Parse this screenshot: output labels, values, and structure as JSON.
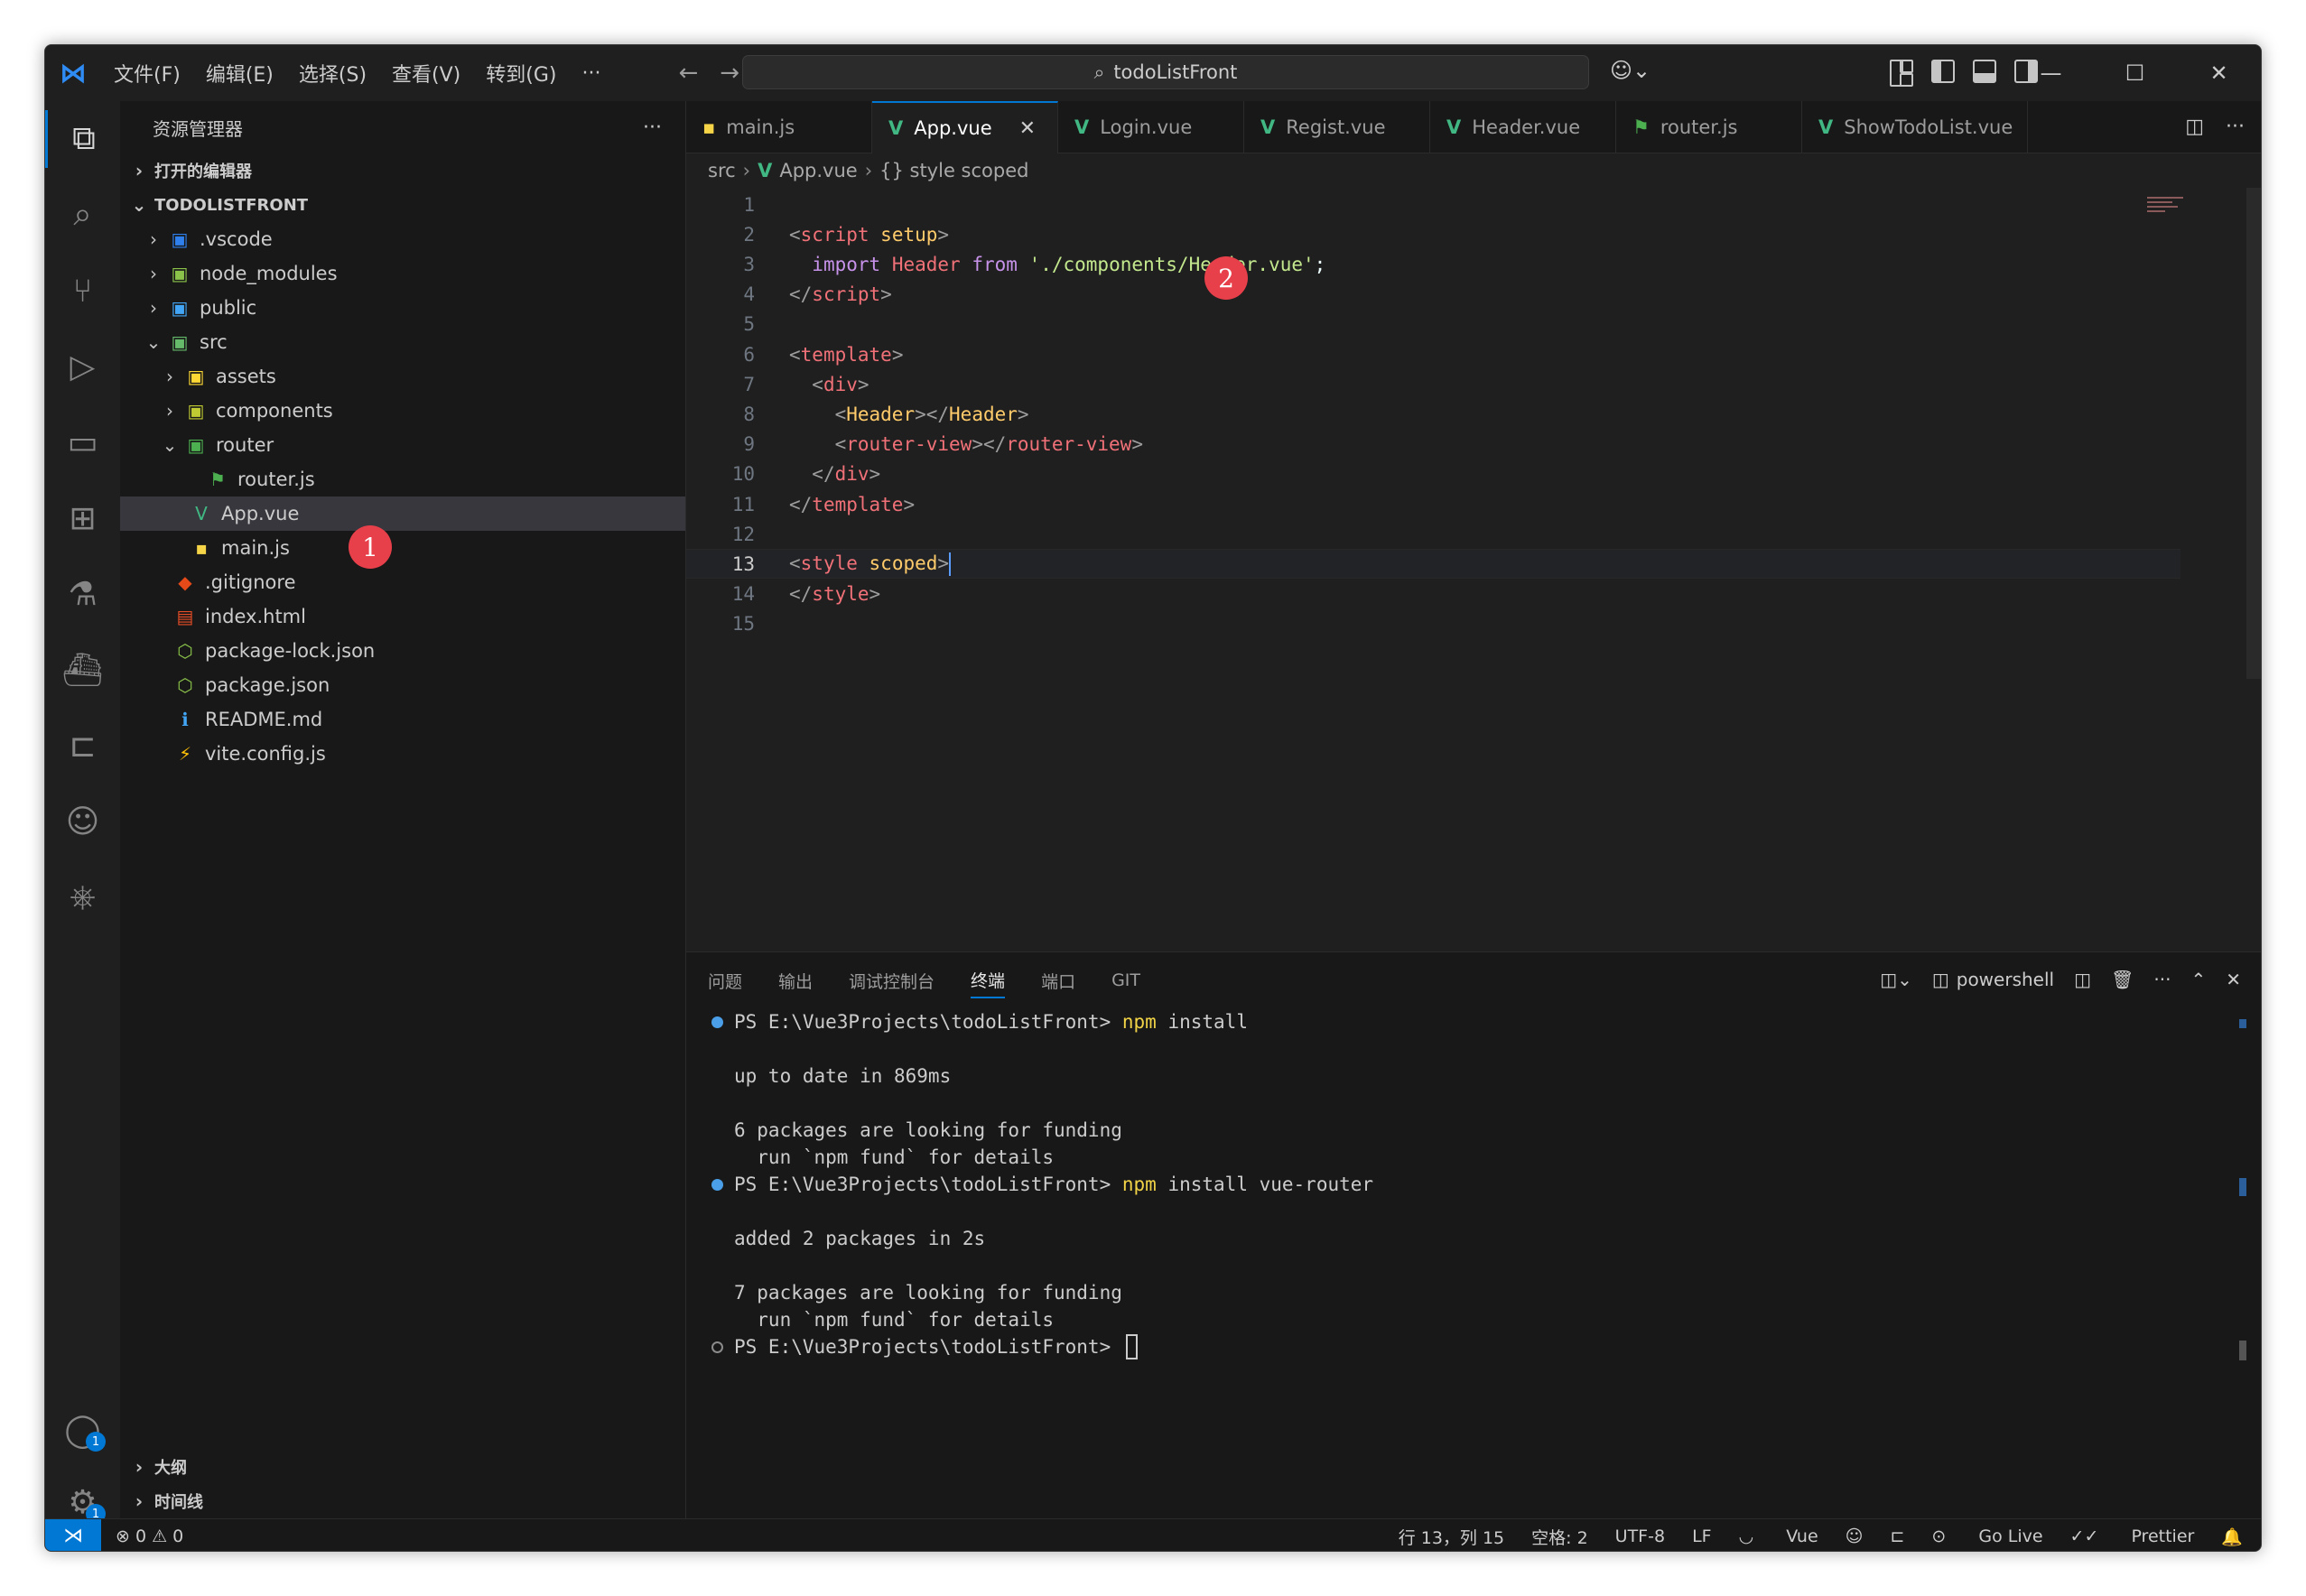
{
  "titlebar": {
    "menu": [
      "文件(F)",
      "编辑(E)",
      "选择(S)",
      "查看(V)",
      "转到(G)",
      "···"
    ],
    "search": "todoListFront",
    "back": "←",
    "forward": "→"
  },
  "sidebar": {
    "title": "资源管理器",
    "more": "···",
    "open_editors": "打开的编辑器",
    "project": "TODOLISTFRONT",
    "outline": "大纲",
    "timeline": "时间线",
    "tree": [
      {
        "label": ".vscode",
        "icon": "vscode-folder-icon",
        "glyph": "▣",
        "color": "#2f80ed",
        "chevron": "›",
        "indent": 0
      },
      {
        "label": "node_modules",
        "icon": "node-folder-icon",
        "glyph": "▣",
        "color": "#8bc34a",
        "chevron": "›",
        "indent": 0
      },
      {
        "label": "public",
        "icon": "public-folder-icon",
        "glyph": "▣",
        "color": "#42a5f5",
        "chevron": "›",
        "indent": 0
      },
      {
        "label": "src",
        "icon": "src-folder-icon",
        "glyph": "▣",
        "color": "#66bb6a",
        "chevron": "⌄",
        "indent": 0
      },
      {
        "label": "assets",
        "icon": "assets-folder-icon",
        "glyph": "▣",
        "color": "#fdd835",
        "chevron": "›",
        "indent": 1
      },
      {
        "label": "components",
        "icon": "components-folder-icon",
        "glyph": "▣",
        "color": "#c0ca33",
        "chevron": "›",
        "indent": 1
      },
      {
        "label": "router",
        "icon": "router-folder-icon",
        "glyph": "▣",
        "color": "#4caf50",
        "chevron": "⌄",
        "indent": 1
      },
      {
        "label": "router.js",
        "icon": "router-file-icon",
        "glyph": "⚑",
        "color": "#4caf50",
        "chevron": "",
        "indent": 2
      },
      {
        "label": "App.vue",
        "icon": "vue-file-icon",
        "glyph": "V",
        "color": "#41b883",
        "chevron": "",
        "indent": 1,
        "selected": true
      },
      {
        "label": "main.js",
        "icon": "js-file-icon",
        "glyph": "▪",
        "color": "#f5d547",
        "chevron": "",
        "indent": 1
      },
      {
        "label": ".gitignore",
        "icon": "git-file-icon",
        "glyph": "◆",
        "color": "#e64a19",
        "chevron": "",
        "indent": 0
      },
      {
        "label": "index.html",
        "icon": "html-file-icon",
        "glyph": "▤",
        "color": "#e44d26",
        "chevron": "",
        "indent": 0
      },
      {
        "label": "package-lock.json",
        "icon": "node-file-icon",
        "glyph": "⬡",
        "color": "#8bc34a",
        "chevron": "",
        "indent": 0
      },
      {
        "label": "package.json",
        "icon": "node-file-icon",
        "glyph": "⬡",
        "color": "#8bc34a",
        "chevron": "",
        "indent": 0
      },
      {
        "label": "README.md",
        "icon": "info-file-icon",
        "glyph": "ℹ",
        "color": "#42a5f5",
        "chevron": "",
        "indent": 0
      },
      {
        "label": "vite.config.js",
        "icon": "vite-file-icon",
        "glyph": "⚡",
        "color": "#ffc107",
        "chevron": "",
        "indent": 0
      }
    ],
    "marker1": "1"
  },
  "tabs": [
    {
      "label": "main.js",
      "icon": "js-file-icon",
      "glyph": "▪",
      "color": "#f5d547"
    },
    {
      "label": "App.vue",
      "icon": "vue-file-icon",
      "glyph": "V",
      "color": "#41b883",
      "active": true
    },
    {
      "label": "Login.vue",
      "icon": "vue-file-icon",
      "glyph": "V",
      "color": "#41b883"
    },
    {
      "label": "Regist.vue",
      "icon": "vue-file-icon",
      "glyph": "V",
      "color": "#41b883"
    },
    {
      "label": "Header.vue",
      "icon": "vue-file-icon",
      "glyph": "V",
      "color": "#41b883"
    },
    {
      "label": "router.js",
      "icon": "router-file-icon",
      "glyph": "⚑",
      "color": "#4caf50"
    },
    {
      "label": "ShowTodoList.vue",
      "icon": "vue-file-icon",
      "glyph": "V",
      "color": "#41b883"
    }
  ],
  "tab_close": "✕",
  "breadcrumb": {
    "folder": "src",
    "file": "App.vue",
    "symbol": "{} style scoped"
  },
  "editor": {
    "marker2": "2",
    "current_line": 13,
    "lines": [
      {
        "n": "1",
        "html": ""
      },
      {
        "n": "2",
        "html": "<span class='t-br'>&lt;</span><span class='t-tag'>script</span> <span class='t-attr'>setup</span><span class='t-br'>&gt;</span>"
      },
      {
        "n": "3",
        "html": "  <span class='t-kw'>import</span> <span class='t-tag'>Header</span> <span class='t-kw'>from</span> <span class='t-str'>'./components/Header.vue'</span><span class='t-plain'>;</span>"
      },
      {
        "n": "4",
        "html": "<span class='t-br'>&lt;/</span><span class='t-tag'>script</span><span class='t-br'>&gt;</span>"
      },
      {
        "n": "5",
        "html": ""
      },
      {
        "n": "6",
        "html": "<span class='t-br'>&lt;</span><span class='t-tag'>template</span><span class='t-br'>&gt;</span>"
      },
      {
        "n": "7",
        "html": "  <span class='t-br'>&lt;</span><span class='t-tag'>div</span><span class='t-br'>&gt;</span>"
      },
      {
        "n": "8",
        "html": "    <span class='t-br'>&lt;</span><span class='t-comp'>Header</span><span class='t-br'>&gt;&lt;/</span><span class='t-comp'>Header</span><span class='t-br'>&gt;</span>"
      },
      {
        "n": "9",
        "html": "    <span class='t-br'>&lt;</span><span class='t-tag'>router-view</span><span class='t-br'>&gt;&lt;/</span><span class='t-tag'>router-view</span><span class='t-br'>&gt;</span>"
      },
      {
        "n": "10",
        "html": "  <span class='t-br'>&lt;/</span><span class='t-tag'>div</span><span class='t-br'>&gt;</span>"
      },
      {
        "n": "11",
        "html": "<span class='t-br'>&lt;/</span><span class='t-tag'>template</span><span class='t-br'>&gt;</span>"
      },
      {
        "n": "12",
        "html": ""
      },
      {
        "n": "13",
        "html": "<span class='t-br'>&lt;</span><span class='t-tag'>style</span> <span class='t-attr'>scoped</span><span class='t-br'>&gt;</span><span class='cursor'></span>"
      },
      {
        "n": "14",
        "html": "<span class='t-br'>&lt;/</span><span class='t-tag'>style</span><span class='t-br'>&gt;</span>"
      },
      {
        "n": "15",
        "html": ""
      }
    ]
  },
  "panel": {
    "tabs": [
      "问题",
      "输出",
      "调试控制台",
      "终端",
      "端口",
      "GIT"
    ],
    "active_tab": "终端",
    "shell": "powershell",
    "terminal": [
      {
        "dot": "blue",
        "prompt": "PS E:\\Vue3Projects\\todoListFront> ",
        "cmd": "npm",
        "args": " install"
      },
      {
        "text": "up to date in 869ms"
      },
      {
        "text": "6 packages are looking for funding"
      },
      {
        "text": "  run `npm fund` for details"
      },
      {
        "dot": "blue",
        "prompt": "PS E:\\Vue3Projects\\todoListFront> ",
        "cmd": "npm",
        "args": " install vue-router"
      },
      {
        "text": "added 2 packages in 2s"
      },
      {
        "text": "7 packages are looking for funding"
      },
      {
        "text": "  run `npm fund` for details"
      },
      {
        "dot": "hollow",
        "prompt": "PS E:\\Vue3Projects\\todoListFront> ",
        "cursor": true
      }
    ]
  },
  "statusbar": {
    "remote": "⋊",
    "problems": "⊗ 0 ⚠ 0",
    "position": "行 13，列 15",
    "spaces": "空格: 2",
    "encoding": "UTF-8",
    "eol": "LF",
    "language": "Vue",
    "golive": "Go Live",
    "prettier": "Prettier"
  },
  "activity_badges": {
    "accounts": "1",
    "settings": "1"
  }
}
